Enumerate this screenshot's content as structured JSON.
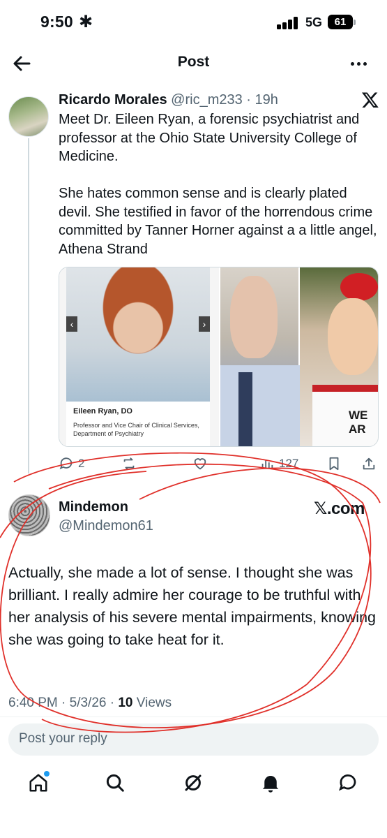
{
  "status_bar": {
    "time": "9:50",
    "network": "5G",
    "battery": "61"
  },
  "header": {
    "title": "Post"
  },
  "parent_post": {
    "author_name": "Ricardo Morales",
    "handle_time": "@ric_m233 · 19h",
    "text": "Meet Dr. Eileen Ryan, a forensic psychiatrist and professor at the Ohio State University College of Medicine.\n\nShe hates common sense and is clearly  plated devil. She testified in favor of the horrendous crime committed by Tanner Horner against a a little angel, Athena Strand",
    "media": {
      "caption_name": "Eileen Ryan, DO",
      "caption_desc": "Professor and Vice Chair of Clinical Services, Department of Psychiatry",
      "shirt_text": "WE AR"
    },
    "stats": {
      "replies": "2",
      "views": "127"
    }
  },
  "reply_post": {
    "author_name": "Mindemon",
    "handle": "@Mindemon61",
    "badge": "𝕏.com",
    "text": "Actually, she made a lot of sense. I thought she was brilliant. I really admire her courage to be truthful with her analysis of his severe mental impairments, knowing she was going to take heat for it.",
    "timestamp": "6:40 PM · 5/3/26 · ",
    "views_count": "10",
    "views_label": " Views"
  },
  "reply_box": {
    "placeholder": "Post your reply"
  },
  "colors": {
    "text": "#0f1419",
    "muted": "#536471",
    "accent": "#1d9bf0",
    "annotation": "#e0302a"
  }
}
